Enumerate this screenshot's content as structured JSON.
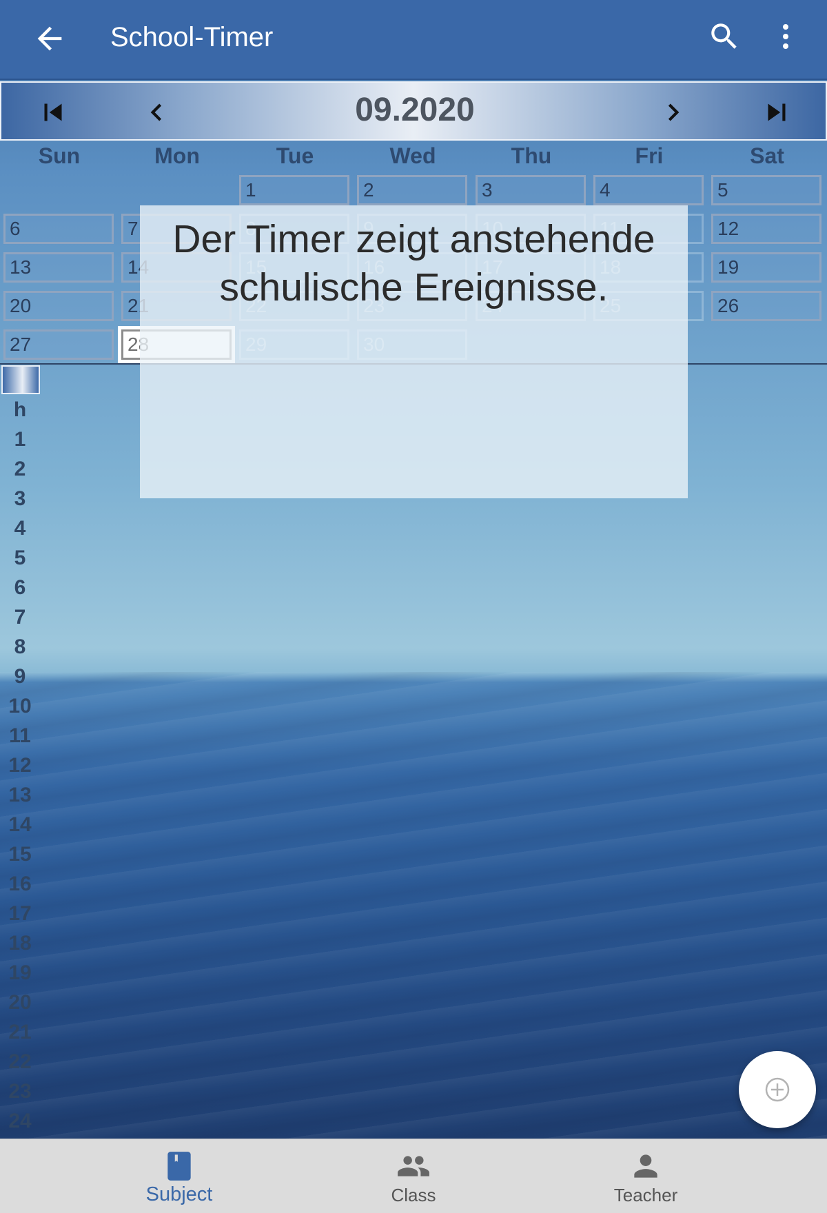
{
  "app_bar": {
    "title": "School-Timer"
  },
  "month_nav": {
    "month": "09.2020"
  },
  "weekdays": [
    "Sun",
    "Mon",
    "Tue",
    "Wed",
    "Thu",
    "Fri",
    "Sat"
  ],
  "days": [
    "1",
    "2",
    "3",
    "4",
    "5",
    "6",
    "7",
    "8",
    "9",
    "10",
    "11",
    "12",
    "13",
    "14",
    "15",
    "16",
    "17",
    "18",
    "19",
    "20",
    "21",
    "22",
    "23",
    "24",
    "25",
    "26",
    "27",
    "28",
    "29",
    "30"
  ],
  "selected_day": "28",
  "hours": [
    "h",
    "1",
    "2",
    "3",
    "4",
    "5",
    "6",
    "7",
    "8",
    "9",
    "10",
    "11",
    "12",
    "13",
    "14",
    "15",
    "16",
    "17",
    "18",
    "19",
    "20",
    "21",
    "22",
    "23",
    "24"
  ],
  "overlay": {
    "text": "Der Timer zeigt anstehende schulische Ereignisse."
  },
  "bottom_nav": {
    "tabs": [
      {
        "label": "Subject",
        "icon": "book-icon",
        "active": true
      },
      {
        "label": "Class",
        "icon": "group-icon",
        "active": false
      },
      {
        "label": "Teacher",
        "icon": "person-icon",
        "active": false
      }
    ]
  },
  "colors": {
    "primary": "#3a68a8",
    "active_tab": "#3a68a8",
    "nav_background": "#dcdcdc"
  }
}
